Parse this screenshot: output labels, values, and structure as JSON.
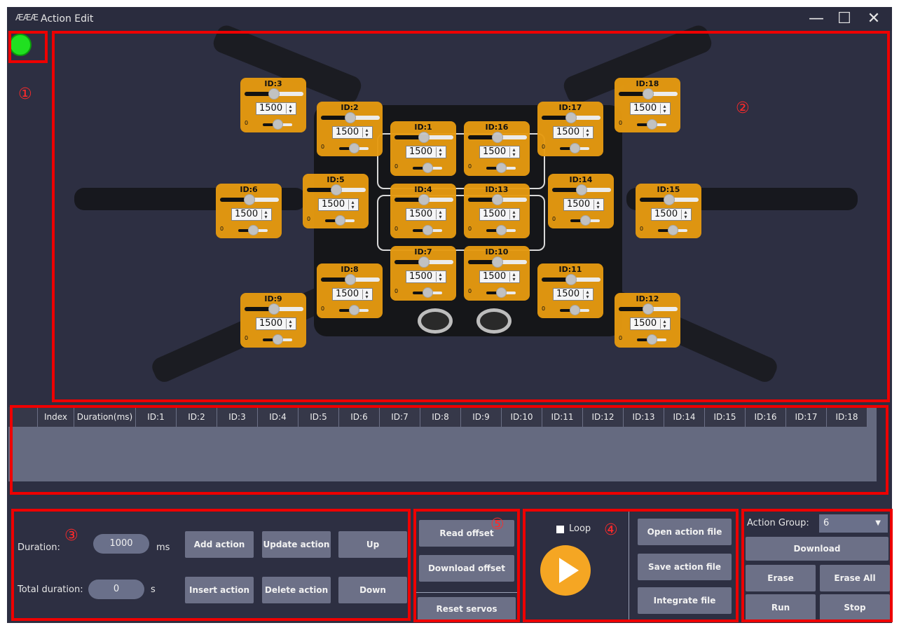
{
  "window": {
    "logo": "ÆÆÆ",
    "title": "Action Edit",
    "minimize": "—",
    "maximize": "☐",
    "close": "✕"
  },
  "markers": [
    "①",
    "②",
    "②",
    "③",
    "④",
    "⑤"
  ],
  "connection_led_color": "#20e020",
  "servos": [
    {
      "id": "ID:3",
      "value": "1500",
      "zero": "0"
    },
    {
      "id": "ID:2",
      "value": "1500",
      "zero": "0"
    },
    {
      "id": "ID:1",
      "value": "1500",
      "zero": "0"
    },
    {
      "id": "ID:16",
      "value": "1500",
      "zero": "0"
    },
    {
      "id": "ID:17",
      "value": "1500",
      "zero": "0"
    },
    {
      "id": "ID:18",
      "value": "1500",
      "zero": "0"
    },
    {
      "id": "ID:6",
      "value": "1500",
      "zero": "0"
    },
    {
      "id": "ID:5",
      "value": "1500",
      "zero": "0"
    },
    {
      "id": "ID:4",
      "value": "1500",
      "zero": "0"
    },
    {
      "id": "ID:13",
      "value": "1500",
      "zero": "0"
    },
    {
      "id": "ID:14",
      "value": "1500",
      "zero": "0"
    },
    {
      "id": "ID:15",
      "value": "1500",
      "zero": "0"
    },
    {
      "id": "ID:8",
      "value": "1500",
      "zero": "0"
    },
    {
      "id": "ID:7",
      "value": "1500",
      "zero": "0"
    },
    {
      "id": "ID:10",
      "value": "1500",
      "zero": "0"
    },
    {
      "id": "ID:11",
      "value": "1500",
      "zero": "0"
    },
    {
      "id": "ID:9",
      "value": "1500",
      "zero": "0"
    },
    {
      "id": "ID:12",
      "value": "1500",
      "zero": "0"
    }
  ],
  "table": {
    "columns": [
      "",
      "Index",
      "Duration(ms)",
      "ID:1",
      "ID:2",
      "ID:3",
      "ID:4",
      "ID:5",
      "ID:6",
      "ID:7",
      "ID:8",
      "ID:9",
      "ID:10",
      "ID:11",
      "ID:12",
      "ID:13",
      "ID:14",
      "ID:15",
      "ID:16",
      "ID:17",
      "ID:18"
    ]
  },
  "action_panel": {
    "duration_label": "Duration:",
    "duration_value": "1000",
    "duration_unit": "ms",
    "total_label": "Total duration:",
    "total_value": "0",
    "total_unit": "s",
    "add": "Add action",
    "update": "Update action",
    "up": "Up",
    "insert": "Insert action",
    "delete": "Delete action",
    "down": "Down"
  },
  "offset_panel": {
    "read": "Read offset",
    "download": "Download offset",
    "reset": "Reset servos"
  },
  "play_panel": {
    "loop": "Loop"
  },
  "file_panel": {
    "open": "Open action file",
    "save": "Save action file",
    "integrate": "Integrate file"
  },
  "group_panel": {
    "label": "Action Group:",
    "selected": "6",
    "download": "Download",
    "erase": "Erase",
    "erase_all": "Erase All",
    "run": "Run",
    "stop": "Stop"
  }
}
